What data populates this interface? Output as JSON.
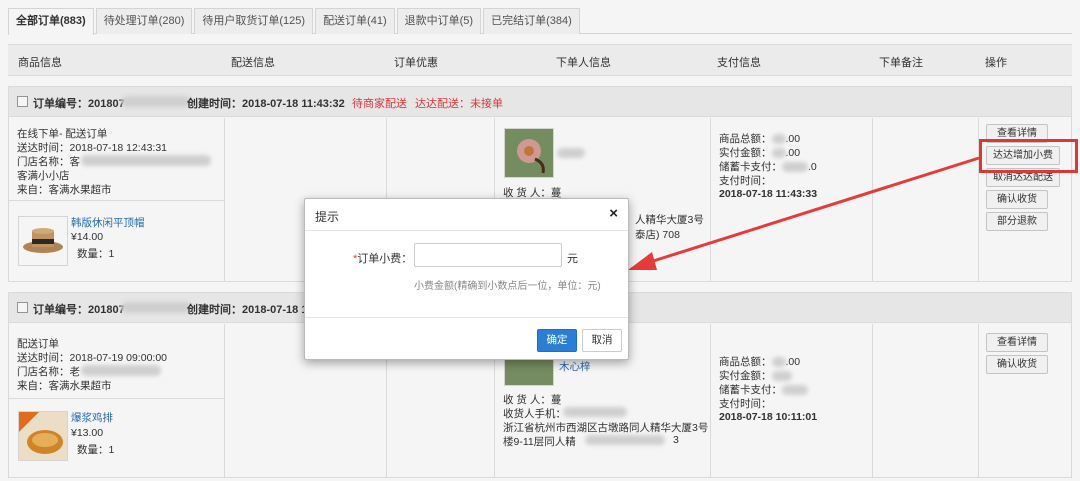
{
  "tabs": [
    {
      "label": "全部订单(883)",
      "active": true
    },
    {
      "label": "待处理订单(280)"
    },
    {
      "label": "待用户取货订单(125)"
    },
    {
      "label": "配送订单(41)"
    },
    {
      "label": "退款中订单(5)"
    },
    {
      "label": "已完结订单(384)"
    }
  ],
  "columns": [
    "商品信息",
    "配送信息",
    "订单优惠",
    "下单人信息",
    "支付信息",
    "下单备注",
    "操作"
  ],
  "orders": [
    {
      "order_no_label": "订单编号：201807",
      "created_label": "创建时间：2018-07-18 11:43:32",
      "status1": "待商家配送",
      "status2": "达达配送：未接单",
      "info": [
        "在线下单- 配送订单",
        "送达时间：2018-07-18 12:43:31",
        "门店名称：客",
        "客满小小店",
        "来自：客满水果超市"
      ],
      "product": {
        "name": "韩版休闲平顶帽",
        "price": "¥14.00",
        "qty": "数量：1"
      },
      "buyer": [
        "收 货 人：蔓",
        "人精华大厦3号",
        "泰店) 708"
      ],
      "pay": [
        "商品总额：",
        "实付金额：",
        "储蓄卡支付：",
        "支付时间：",
        "2018-07-18 11:43:33"
      ],
      "pay_tail": [
        ".00",
        ".00",
        ".0"
      ],
      "actions": [
        "查看详情",
        "达达增加小费",
        "取消达达配送",
        "确认收货",
        "部分退款"
      ]
    },
    {
      "order_no_label": "订单编号：201807",
      "created_label": "创建时间：2018-07-18 10",
      "info": [
        "配送订单",
        "送达时间：2018-07-19 09:00:00",
        "门店名称：老",
        "来自：客满水果超市"
      ],
      "product": {
        "name": "爆浆鸡排",
        "price": "¥13.00",
        "qty": "数量：1"
      },
      "buyer": [
        "木心梓",
        "收 货 人：蔓",
        "收货人手机：",
        "浙江省杭州市西湖区古墩路同人精华大厦3号",
        "楼9-11层同人精",
        "3"
      ],
      "pay": [
        "商品总额：",
        "实付金额：",
        "储蓄卡支付：",
        "支付时间：",
        "2018-07-18 10:11:01"
      ],
      "pay_tail": [
        ".00"
      ],
      "actions": [
        "查看详情",
        "确认收货"
      ]
    }
  ],
  "dialog": {
    "title": "提示",
    "close": "×",
    "required_mark": "*",
    "label": "订单小费：",
    "input_value": "",
    "unit": "元",
    "help": "小费金额(精确到小数点后一位，单位：元)",
    "ok": "确定",
    "cancel": "取消"
  },
  "colors": {
    "accent": "#2a7fd4",
    "alert": "#e4393c",
    "annotation": "#e53b3b"
  }
}
